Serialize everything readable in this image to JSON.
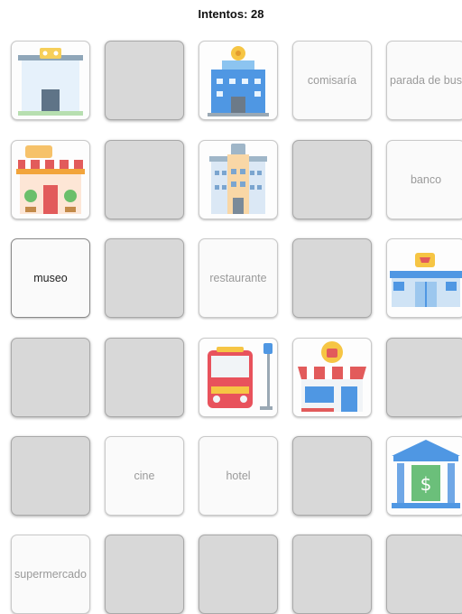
{
  "header": {
    "attempts": "Intentos: 28"
  },
  "board": {
    "cards": [
      {
        "state": "image",
        "icon": "building-icon"
      },
      {
        "state": "hidden"
      },
      {
        "state": "image",
        "icon": "police-station-icon"
      },
      {
        "state": "word",
        "text": "comisaría"
      },
      {
        "state": "word",
        "text": "parada de bus"
      },
      {
        "state": "image",
        "icon": "restaurant-icon"
      },
      {
        "state": "hidden"
      },
      {
        "state": "image",
        "icon": "hotel-icon"
      },
      {
        "state": "hidden"
      },
      {
        "state": "word",
        "text": "banco"
      },
      {
        "state": "word-current",
        "text": "museo"
      },
      {
        "state": "hidden"
      },
      {
        "state": "word",
        "text": "restaurante"
      },
      {
        "state": "hidden"
      },
      {
        "state": "image",
        "icon": "supermarket-icon"
      },
      {
        "state": "hidden"
      },
      {
        "state": "hidden"
      },
      {
        "state": "image",
        "icon": "bus-stop-icon"
      },
      {
        "state": "image",
        "icon": "shop-icon"
      },
      {
        "state": "hidden"
      },
      {
        "state": "hidden"
      },
      {
        "state": "word",
        "text": "cine"
      },
      {
        "state": "word",
        "text": "hotel"
      },
      {
        "state": "hidden"
      },
      {
        "state": "image",
        "icon": "bank-icon"
      },
      {
        "state": "word",
        "text": "supermercado"
      },
      {
        "state": "hidden"
      },
      {
        "state": "hidden"
      },
      {
        "state": "hidden"
      },
      {
        "state": "hidden"
      }
    ]
  }
}
